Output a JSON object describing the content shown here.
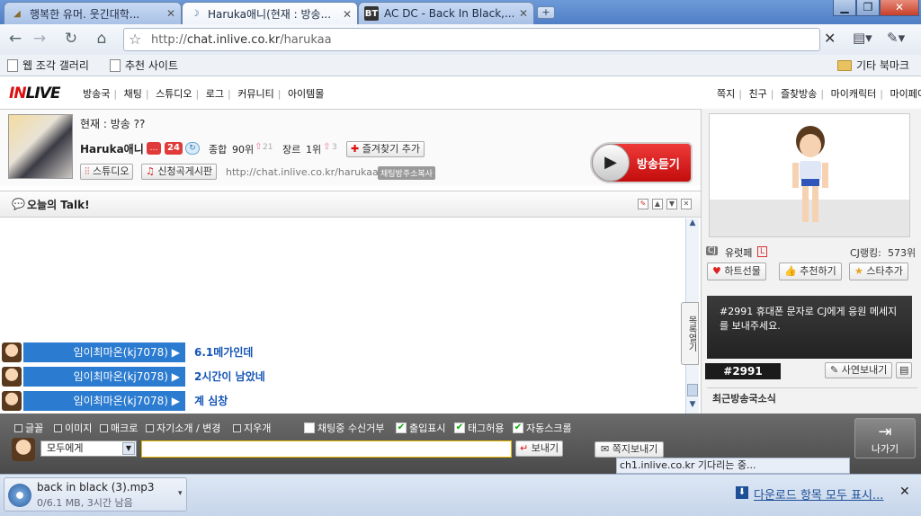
{
  "browser": {
    "tabs": [
      {
        "title": "행복한 유머. 웃긴대학...",
        "icon": "snail-icon"
      },
      {
        "title": "Haruka애니(현재 : 방송...",
        "icon": "moon-icon"
      },
      {
        "title": "AC DC - Back In Black,...",
        "icon": "bt-icon"
      }
    ],
    "url_scheme": "http://",
    "url_host": "chat.inlive.co.kr",
    "url_path": "/harukaa",
    "bookmarks": [
      "웹 조각 갤러리",
      "추천 사이트"
    ],
    "other_bookmarks": "기타 북마크"
  },
  "site": {
    "logo_prefix": "IN",
    "logo_suffix": "LIVE",
    "nav": [
      "방송국",
      "채팅",
      "스튜디오",
      "로그",
      "커뮤니티",
      "아이템몰"
    ],
    "user_nav": [
      "쪽지",
      "친구",
      "즐찾방송",
      "마이캐릭터",
      "마이페이지"
    ]
  },
  "broadcast": {
    "status": "현재 : 방송 ??",
    "name": "Haruka애니",
    "badge_count": "24",
    "overall_rank_label": "종합",
    "overall_rank": "90위",
    "overall_change": "21",
    "genre_rank_label": "장르",
    "genre_rank": "1위",
    "genre_change": "3",
    "fav_button": "즐겨찾기 추가",
    "studio_button": "스튜디오",
    "request_button": "신청곡게시판",
    "url": "http://chat.inlive.co.kr/harukaa",
    "copy_button": "채팅방주소복사",
    "listen_button": "방송듣기"
  },
  "talk": {
    "title": "오늘의 Talk!"
  },
  "chat": {
    "messages": [
      {
        "user": "임이최마온(kj7078)",
        "text": "6.1메가인데"
      },
      {
        "user": "임이최마온(kj7078)",
        "text": "2시간이 남았네"
      },
      {
        "user": "임이최마온(kj7078)",
        "text": "계 심창"
      }
    ],
    "side_tab": "목록열기"
  },
  "profile": {
    "cj_badge": "CJ",
    "nick": "유럿페",
    "level_badge": "L",
    "rank_label": "CJ랭킹:",
    "rank": "573위",
    "heart_button": "하트선물",
    "recommend_button": "추천하기",
    "star_button": "스타추가",
    "notice": "#2991 휴대폰 문자로 CJ에게 응원 메세지를 보내주세요.",
    "notice_num": "#2991",
    "story_button": "사연보내기",
    "recent_title": "최근방송국소식"
  },
  "chat_controls": {
    "tools": [
      "글꼴",
      "이미지",
      "매크로",
      "자기소개 / 변경",
      "지우개"
    ],
    "checks": [
      {
        "label": "채팅중 수신거부",
        "checked": false
      },
      {
        "label": "출입표시",
        "checked": true
      },
      {
        "label": "태그허용",
        "checked": true
      },
      {
        "label": "자동스크롤",
        "checked": true
      }
    ],
    "recipient": "모두에게",
    "send_button": "보내기",
    "note_button": "쪽지보내기",
    "exit_button": "나가기",
    "status": "ch1.inlive.co.kr 기다리는 중..."
  },
  "downloads": {
    "file": "back in black (3).mp3",
    "progress": "0/6.1 MB, 3시간 남음",
    "show_all": "다운로드 항목 모두 표시..."
  }
}
